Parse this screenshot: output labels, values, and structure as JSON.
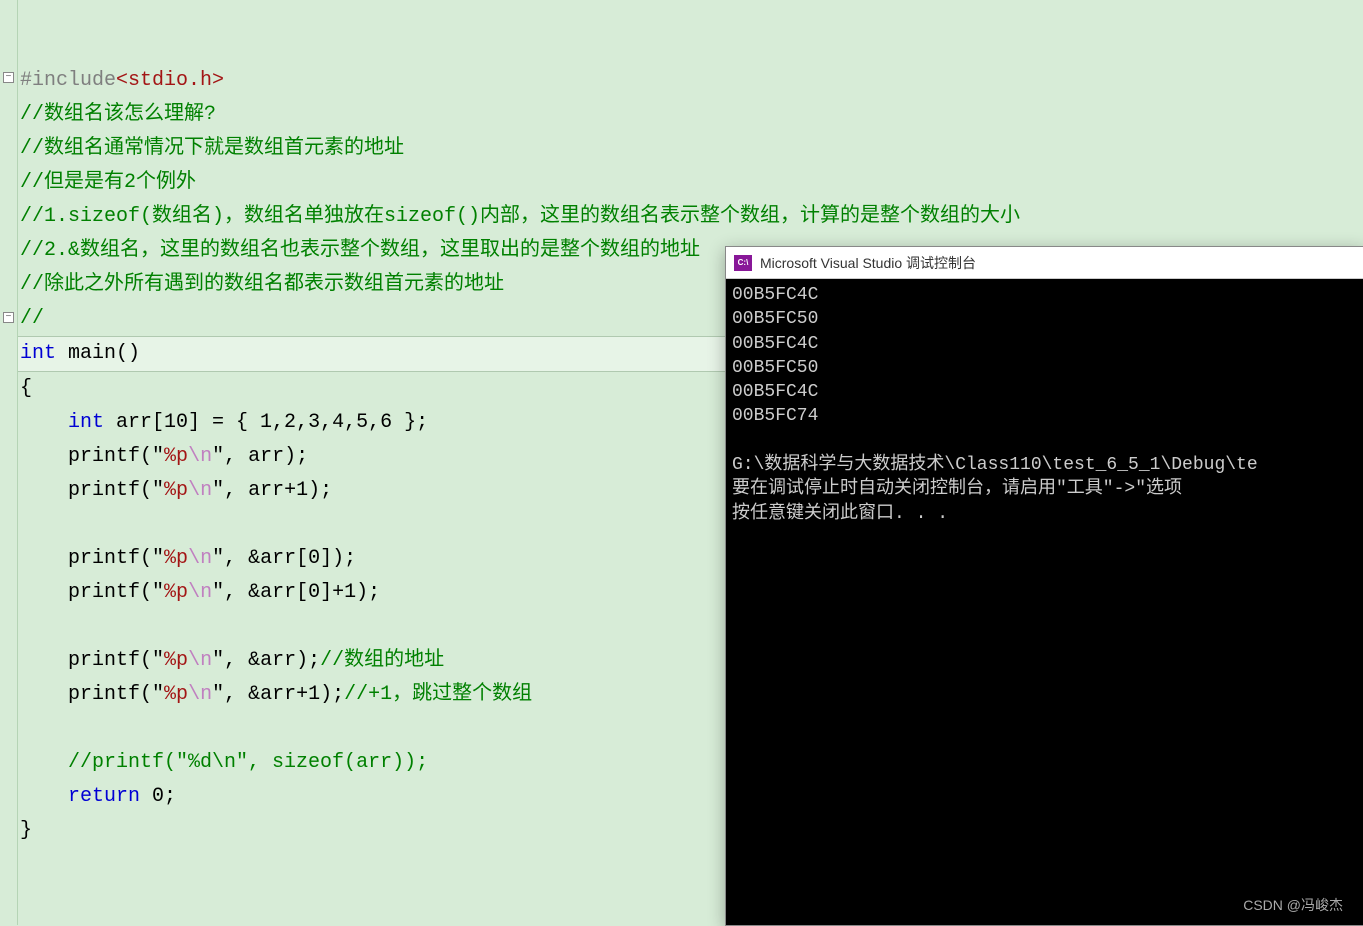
{
  "code": {
    "include_directive": "#include",
    "include_header": "<stdio.h>",
    "comments": {
      "c1": "//数组名该怎么理解?",
      "c2": "//数组名通常情况下就是数组首元素的地址",
      "c3": "//但是是有2个例外",
      "c4": "//1.sizeof(数组名)，数组名单独放在sizeof()内部，这里的数组名表示整个数组，计算的是整个数组的大小",
      "c5": "//2.&数组名，这里的数组名也表示整个数组，这里取出的是整个数组的地址",
      "c6": "//除此之外所有遇到的数组名都表示数组首元素的地址",
      "c7": "//",
      "c_addr": "//数组的地址",
      "c_skip": "//+1，跳过整个数组",
      "c_printf_sizeof": "//printf(\"%d\\n\", sizeof(arr));"
    },
    "kw_int": "int",
    "kw_return": "return",
    "fn_main": "main()",
    "brace_open": "{",
    "brace_close": "}",
    "decl_arr_pre": "    ",
    "decl_arr": " arr[10] = { 1,2,3,4,5,6 };",
    "printf": "printf",
    "fmt_p_open": "(\"",
    "fmt_p": "%p",
    "fmt_esc": "\\n",
    "fmt_close": "\"",
    "arg_arr": ", arr);",
    "arg_arr1": ", arr+1);",
    "arg_amp_arr0": ", &arr[0]);",
    "arg_amp_arr0_1": ", &arr[0]+1);",
    "arg_amp_arr": ", &arr);",
    "arg_amp_arr_1": ", &arr+1);",
    "ret_zero": " 0;"
  },
  "console": {
    "title": "Microsoft Visual Studio 调试控制台",
    "icon_text": "C:\\",
    "output": [
      "00B5FC4C",
      "00B5FC50",
      "00B5FC4C",
      "00B5FC50",
      "00B5FC4C",
      "00B5FC74",
      "",
      "G:\\数据科学与大数据技术\\Class110\\test_6_5_1\\Debug\\te",
      "要在调试停止时自动关闭控制台，请启用\"工具\"->\"选项",
      "按任意键关闭此窗口. . ."
    ]
  },
  "watermark": "CSDN @冯峻杰"
}
